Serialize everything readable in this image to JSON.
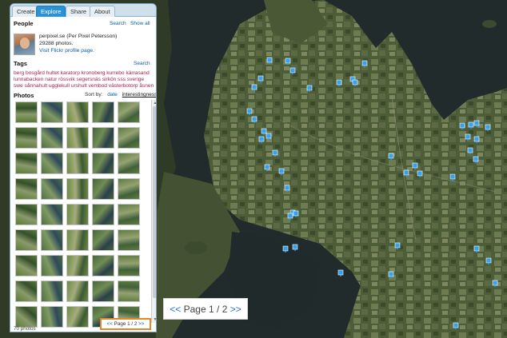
{
  "tabs": [
    "Create",
    "Explore",
    "Share",
    "About"
  ],
  "active_tab": "Explore",
  "people": {
    "heading": "People",
    "search_label": "Search",
    "show_all_label": "Show all",
    "username": "perpixel.se (Per Pixel Petersson)",
    "photo_count": "29288 photos.",
    "profile_link": "Visit Flickr profile page."
  },
  "tags": {
    "heading": "Tags",
    "search_label": "Search",
    "items": [
      "berg",
      "bosgård",
      "hultet",
      "karatorp",
      "kronoberg",
      "kurrebo",
      "kärrasand",
      "lunnabacken",
      "natur",
      "rössvik",
      "segersnäs",
      "sirkön",
      "sss",
      "sverige",
      "swe",
      "sånnahult",
      "ugglekull",
      "urshult",
      "vembod",
      "västerbotorp",
      "åsnen"
    ]
  },
  "photos": {
    "heading": "Photos",
    "sort_by_label": "Sort by:",
    "sort_options": [
      "date",
      "interestingness"
    ],
    "selected_sort": "interestingness",
    "total_label": "70 photos",
    "thumbnail_count": 45
  },
  "small_pager": {
    "prev": "<<",
    "page_label": "Page 1 / 2",
    "next": ">>"
  },
  "large_pager": {
    "prev": "<<",
    "page_word": "Page",
    "current": "1",
    "separator": "/",
    "total": "2",
    "next": ">>"
  },
  "colors": {
    "pin": "#3aa0e8",
    "accent_tab": "#2a92d8",
    "pager_highlight": "#e6862a",
    "tag_text": "#b0204e",
    "water": "#212a2a",
    "land": "#4f5e3b"
  },
  "icons": [
    "map-pin-icon",
    "scroll-up-icon",
    "scroll-down-icon"
  ]
}
